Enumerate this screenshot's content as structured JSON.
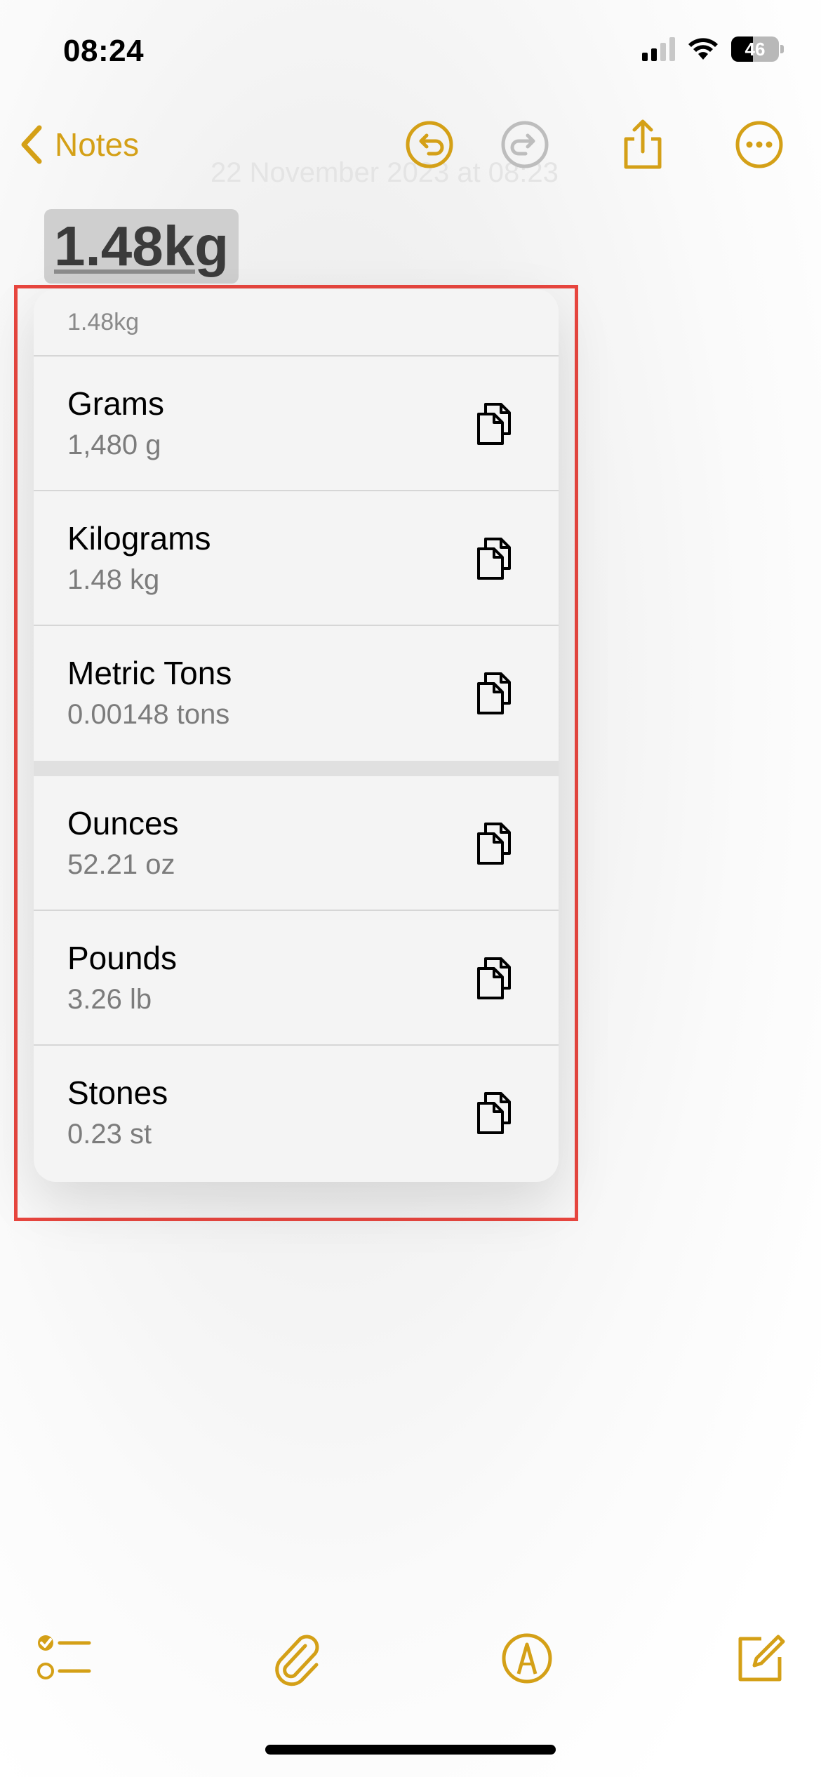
{
  "status_bar": {
    "time": "08:24",
    "battery_level": "46"
  },
  "nav": {
    "back_label": "Notes"
  },
  "note": {
    "text": "1.48kg",
    "faint_date": "22 November 2023 at 08:23"
  },
  "menu": {
    "header": "1.48kg",
    "group_metric": [
      {
        "title": "Grams",
        "value": "1,480 g"
      },
      {
        "title": "Kilograms",
        "value": "1.48 kg"
      },
      {
        "title": "Metric Tons",
        "value": "0.00148 tons"
      }
    ],
    "group_imperial": [
      {
        "title": "Ounces",
        "value": "52.21 oz"
      },
      {
        "title": "Pounds",
        "value": "3.26 lb"
      },
      {
        "title": "Stones",
        "value": "0.23 st"
      }
    ]
  },
  "colors": {
    "accent": "#d4a017",
    "highlight": "#e8463f"
  },
  "icons": {
    "nav": [
      "chevron-left-icon",
      "undo-icon",
      "redo-icon",
      "share-icon",
      "more-icon"
    ],
    "toolbar": [
      "checklist-icon",
      "paperclip-icon",
      "markup-pen-icon",
      "compose-icon"
    ],
    "row": "copy-icon"
  }
}
